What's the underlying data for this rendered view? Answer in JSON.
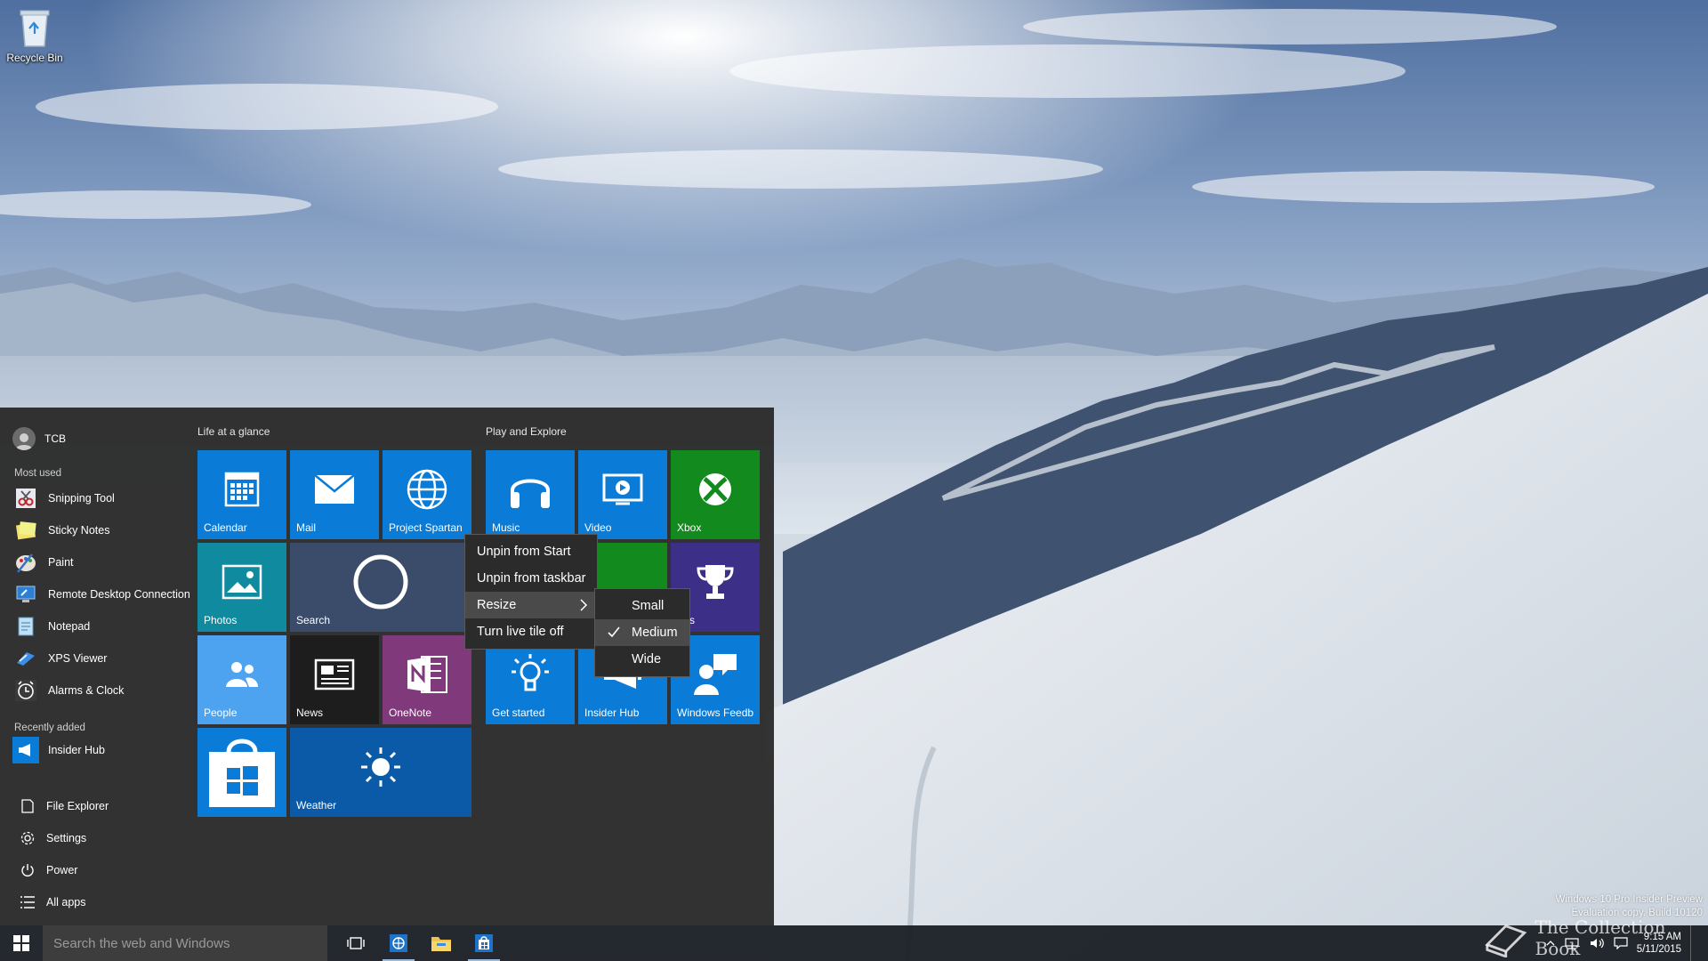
{
  "desktop": {
    "recycle_bin_label": "Recycle Bin"
  },
  "start_menu": {
    "user_name": "TCB",
    "most_used_label": "Most used",
    "most_used": [
      {
        "label": "Snipping Tool",
        "icon": "scissors-icon"
      },
      {
        "label": "Sticky Notes",
        "icon": "sticky-note-icon"
      },
      {
        "label": "Paint",
        "icon": "palette-icon"
      },
      {
        "label": "Remote Desktop Connection",
        "icon": "remote-desktop-icon"
      },
      {
        "label": "Notepad",
        "icon": "notepad-icon"
      },
      {
        "label": "XPS Viewer",
        "icon": "xps-icon"
      },
      {
        "label": "Alarms & Clock",
        "icon": "clock-icon"
      }
    ],
    "recently_added_label": "Recently added",
    "recently_added": [
      {
        "label": "Insider Hub",
        "icon": "megaphone-icon"
      }
    ],
    "bottom": {
      "file_explorer": "File Explorer",
      "settings": "Settings",
      "power": "Power",
      "all_apps": "All apps"
    },
    "groups": {
      "life": "Life at a glance",
      "play": "Play and Explore"
    },
    "tiles": {
      "calendar": "Calendar",
      "mail": "Mail",
      "project_spartan": "Project Spartan",
      "photos": "Photos",
      "search": "Search",
      "people": "People",
      "news": "News",
      "onenote": "OneNote",
      "store": "",
      "weather": "Weather",
      "music": "Music",
      "video": "Video",
      "xbox": "Xbox",
      "sports": "orts",
      "get_started": "Get started",
      "insider_hub": "Insider Hub",
      "windows_feedback": "Windows Feedb"
    }
  },
  "context_menu": {
    "items": [
      "Unpin from Start",
      "Unpin from taskbar",
      "Resize",
      "Turn live tile off"
    ],
    "active_index": 2
  },
  "resize_submenu": {
    "items": [
      "Small",
      "Medium",
      "Wide"
    ],
    "checked": "Medium"
  },
  "taskbar": {
    "search_placeholder": "Search the web and Windows",
    "time": "9:15 AM",
    "date": "5/11/2015"
  },
  "watermark": {
    "line1": "Windows 10 Pro Insider Preview",
    "line2": "Evaluation copy. Build 10120"
  },
  "overlay": {
    "logo_text": "The Collection Book"
  },
  "colors": {
    "tile_blue": "#0a7bd6",
    "tile_teal": "#0f8a9e",
    "tile_green": "#138a1e",
    "tile_purple": "#3b2f88",
    "tile_onenote": "#80397b",
    "tile_darkblue": "#0b5aa8",
    "tile_light": "#4ea3f0"
  }
}
